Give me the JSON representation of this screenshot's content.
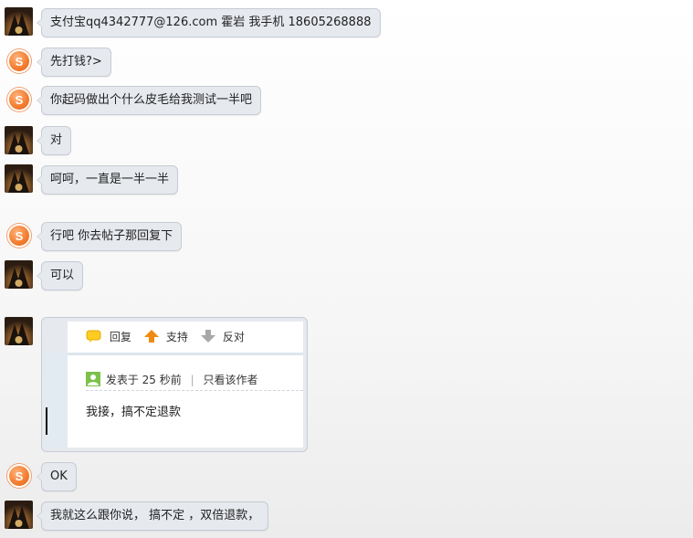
{
  "messages": [
    {
      "avatar": "dark",
      "text": "支付宝qq4342777@126.com   霍岩  我手机 18605268888"
    },
    {
      "avatar": "logo",
      "text": "先打钱?>"
    },
    {
      "avatar": "logo",
      "text": "你起码做出个什么皮毛给我测试一半吧"
    },
    {
      "avatar": "dark",
      "text": "对"
    },
    {
      "avatar": "dark",
      "text": "呵呵，一直是一半一半"
    },
    {
      "avatar": "logo",
      "text": "行吧 你去帖子那回复下"
    },
    {
      "avatar": "dark",
      "text": "可以"
    },
    {
      "avatar": "logo",
      "text": "OK"
    },
    {
      "avatar": "dark",
      "text": "我就这么跟你说， 搞不定 ，双倍退款，"
    }
  ],
  "card": {
    "reply_label": "回复",
    "support_label": "支持",
    "oppose_label": "反对",
    "posted_label": "发表于 25 秒前",
    "separator": "|",
    "author_only_label": "只看该作者",
    "content": "我接，搞不定退款"
  },
  "colors": {
    "bubble_bg": "#e6e9ee",
    "bubble_border": "#c6ccd6",
    "support_arrow": "#f08a10",
    "oppose_arrow": "#9a9a9a",
    "logo": "#f27a2a"
  }
}
